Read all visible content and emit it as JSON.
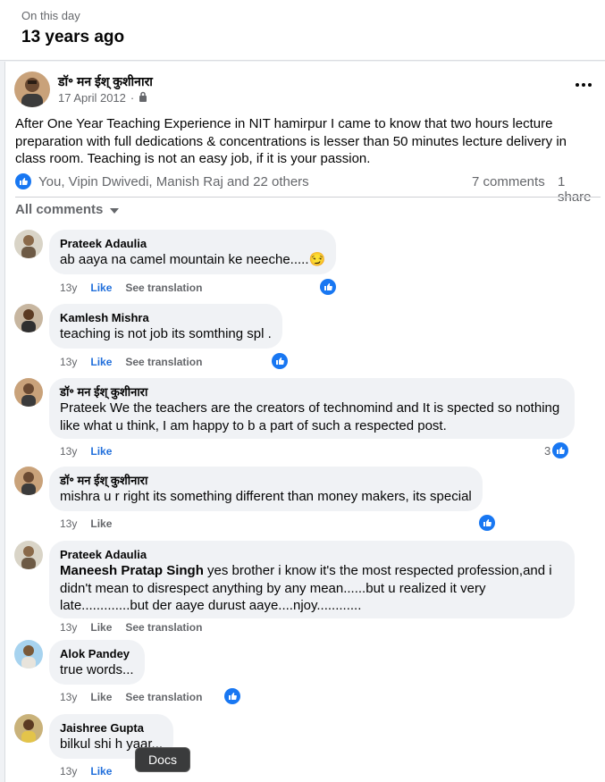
{
  "colors": {
    "accent": "#216fdb",
    "like_blue": "#0866ff",
    "muted": "#65676b",
    "bubble": "#f0f2f5"
  },
  "header": {
    "label": "On this day",
    "title": "13 years ago"
  },
  "post": {
    "author": "डॉ॰ मन ईश् कुशीनारा",
    "date": "17 April 2012",
    "separator": "·",
    "privacy_icon": "lock-icon",
    "more_icon": "more-options-icon",
    "text": "After One Year Teaching Experience in NIT hamirpur I came to know that  two hours lecture preparation with full dedications & concentrations is lesser than 50 minutes lecture delivery in class room. Teaching is not an easy job, if it is your passion.",
    "reactions_text": "You, Vipin Dwivedi, Manish Raj and 22 others",
    "comments_count": "7 comments",
    "shares_count": "1 share"
  },
  "comments_header": {
    "label": "All comments"
  },
  "comments": [
    {
      "name": "Prateek Adaulia",
      "text": "ab aaya na camel mountain ke neeche.....",
      "emoji": "😏",
      "age": "13y",
      "like": "Like",
      "translate": "See translation",
      "react_count": ""
    },
    {
      "name": "Kamlesh Mishra",
      "text": "teaching is not job its somthing spl .",
      "age": "13y",
      "like": "Like",
      "translate": "See translation",
      "react_count": ""
    },
    {
      "name": "डॉ॰ मन ईश् कुशीनारा",
      "text": "Prateek We the teachers are the creators of technomind and It is spected so nothing like what u think, I am happy to b a part of such a respected post.",
      "age": "13y",
      "like": "Like",
      "react_count": "3"
    },
    {
      "name": "डॉ॰ मन ईश् कुशीनारा",
      "text": "mishra u r right its something different than money makers, its special",
      "age": "13y",
      "like": "Like",
      "react_count": ""
    },
    {
      "name": "Prateek Adaulia",
      "mention": "Maneesh Pratap Singh",
      "text": " yes brother i know it's the most respected profession,and i didn't mean to disrespect anything by any mean......but u realized it very late.............but der aaye durust aaye....njoy............",
      "age": "13y",
      "like": "Like",
      "translate": "See translation",
      "react_count": ""
    },
    {
      "name": "Alok Pandey",
      "text": "true words...",
      "age": "13y",
      "like": "Like",
      "translate": "See translation",
      "react_count": ""
    },
    {
      "name": "Jaishree Gupta",
      "text": "bilkul shi h yaar...",
      "age": "13y",
      "like": "Like",
      "react_count": ""
    }
  ],
  "tooltip": {
    "label": "Docs"
  }
}
